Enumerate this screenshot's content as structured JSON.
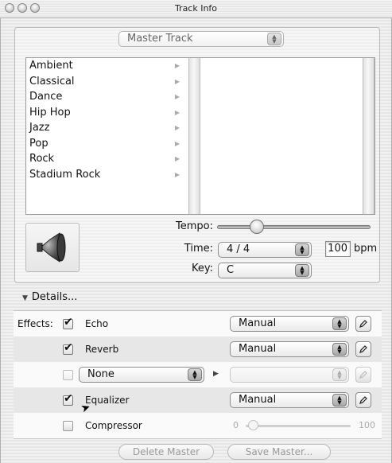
{
  "window": {
    "title": "Track Info"
  },
  "track_select": {
    "value": "Master Track"
  },
  "genres": [
    "Ambient",
    "Classical",
    "Dance",
    "Hip Hop",
    "Jazz",
    "Pop",
    "Rock",
    "Stadium Rock"
  ],
  "tempo": {
    "label": "Tempo:"
  },
  "time": {
    "label": "Time:",
    "value": "4 / 4"
  },
  "bpm": {
    "value": "100",
    "unit": "bpm"
  },
  "key": {
    "label": "Key:",
    "value": "C"
  },
  "details": {
    "label": "Details..."
  },
  "effects": {
    "caption": "Effects:",
    "rows": [
      {
        "name": "Echo",
        "checked": true,
        "preset": "Manual"
      },
      {
        "name": "Reverb",
        "checked": true,
        "preset": "Manual"
      },
      {
        "name": "None",
        "checked": false,
        "preset": ""
      },
      {
        "name": "Equalizer",
        "checked": true,
        "preset": "Manual"
      },
      {
        "name": "Compressor",
        "checked": false,
        "min": "0",
        "max": "100"
      }
    ]
  },
  "buttons": {
    "delete": "Delete Master",
    "save": "Save Master..."
  },
  "icons": [
    "speaker-icon",
    "disclosure-triangle-icon",
    "pencil-icon",
    "submenu-arrow-icon",
    "pointer-cursor-icon"
  ]
}
